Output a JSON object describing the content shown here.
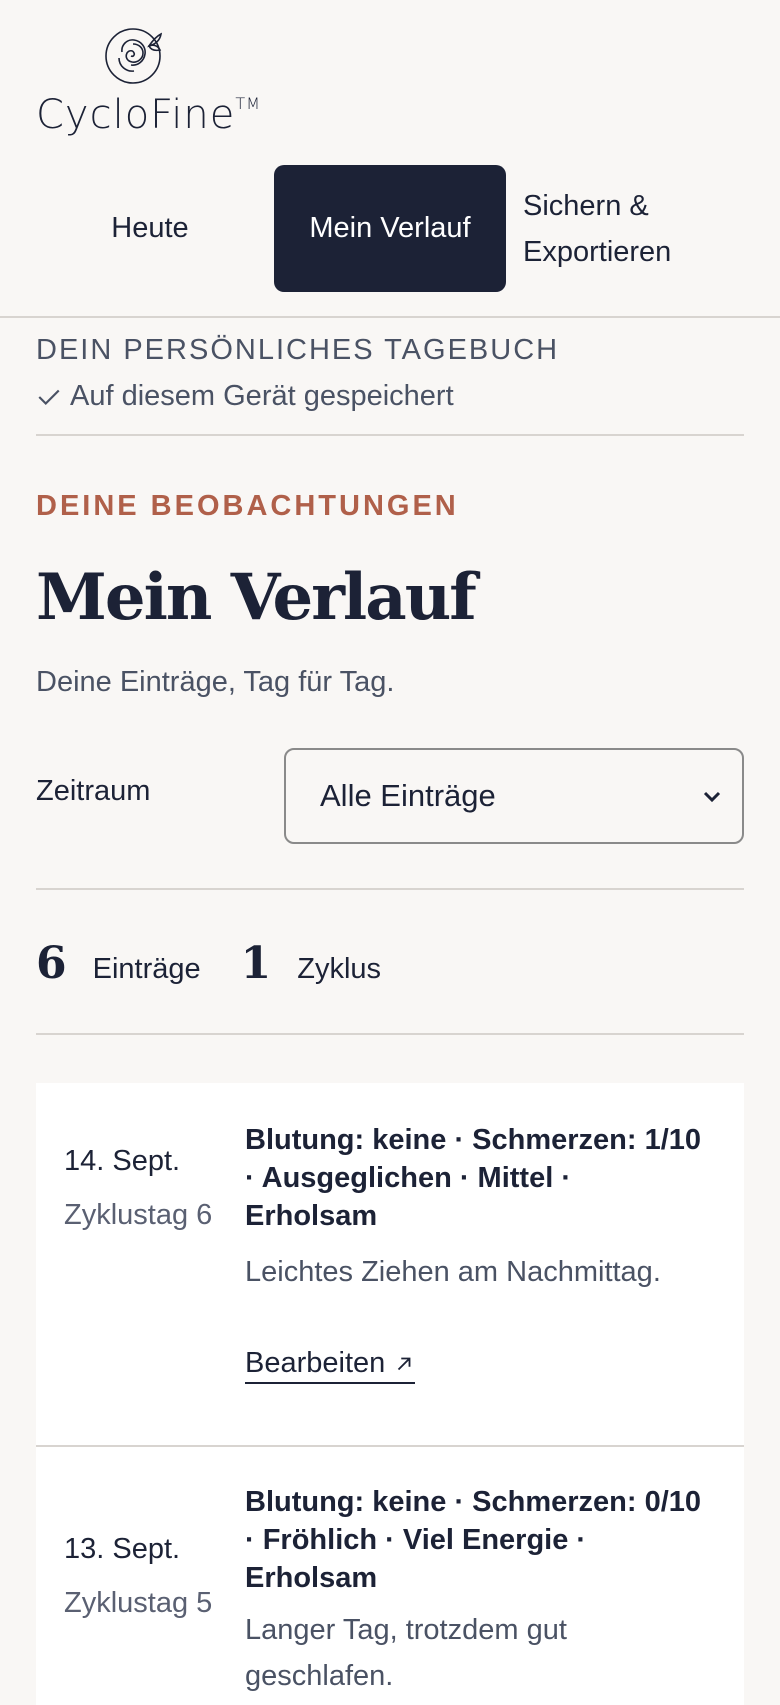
{
  "brand": {
    "name": "CycloFine",
    "tm": "TM"
  },
  "nav": {
    "items": [
      {
        "label": "Heute"
      },
      {
        "label": "Mein Verlauf"
      },
      {
        "label": "Sichern & Exportieren"
      }
    ],
    "active": "Mein Verlauf"
  },
  "diary": {
    "label": "DEIN PERSÖNLICHES TAGEBUCH",
    "saved": "Auf diesem Gerät gespeichert"
  },
  "header": {
    "eyebrow": "DEINE BEOBACHTUNGEN",
    "title": "Mein Verlauf",
    "subtitle": "Deine Einträge, Tag für Tag."
  },
  "filter": {
    "label": "Zeitraum",
    "selected": "Alle Einträge"
  },
  "stats": {
    "entries_count": "6",
    "entries_label": "Einträge",
    "cycles_count": "1",
    "cycles_label": "Zyklus"
  },
  "entries": [
    {
      "date": "14. Sept.",
      "cycle_day": "Zyklustag 6",
      "summary": "Blutung: keine · Schmerzen: 1/10 · Ausgeglichen · Mittel · Erholsam",
      "note": "Leichtes Ziehen am Nachmittag.",
      "edit_label": "Bearbeiten"
    },
    {
      "date": "13. Sept.",
      "cycle_day": "Zyklustag 5",
      "summary": "Blutung: keine · Schmerzen: 0/10 · Fröhlich · Viel Energie · Erholsam",
      "note": "Langer Tag, trotzdem gut geschlafen."
    }
  ],
  "colors": {
    "navy": "#1c2236",
    "accent": "#b0604a",
    "background": "#f9f7f5",
    "card": "#ffffff"
  },
  "icons": [
    "rose-logo-icon",
    "check-icon",
    "chevron-down-icon",
    "arrow-up-right-icon"
  ]
}
